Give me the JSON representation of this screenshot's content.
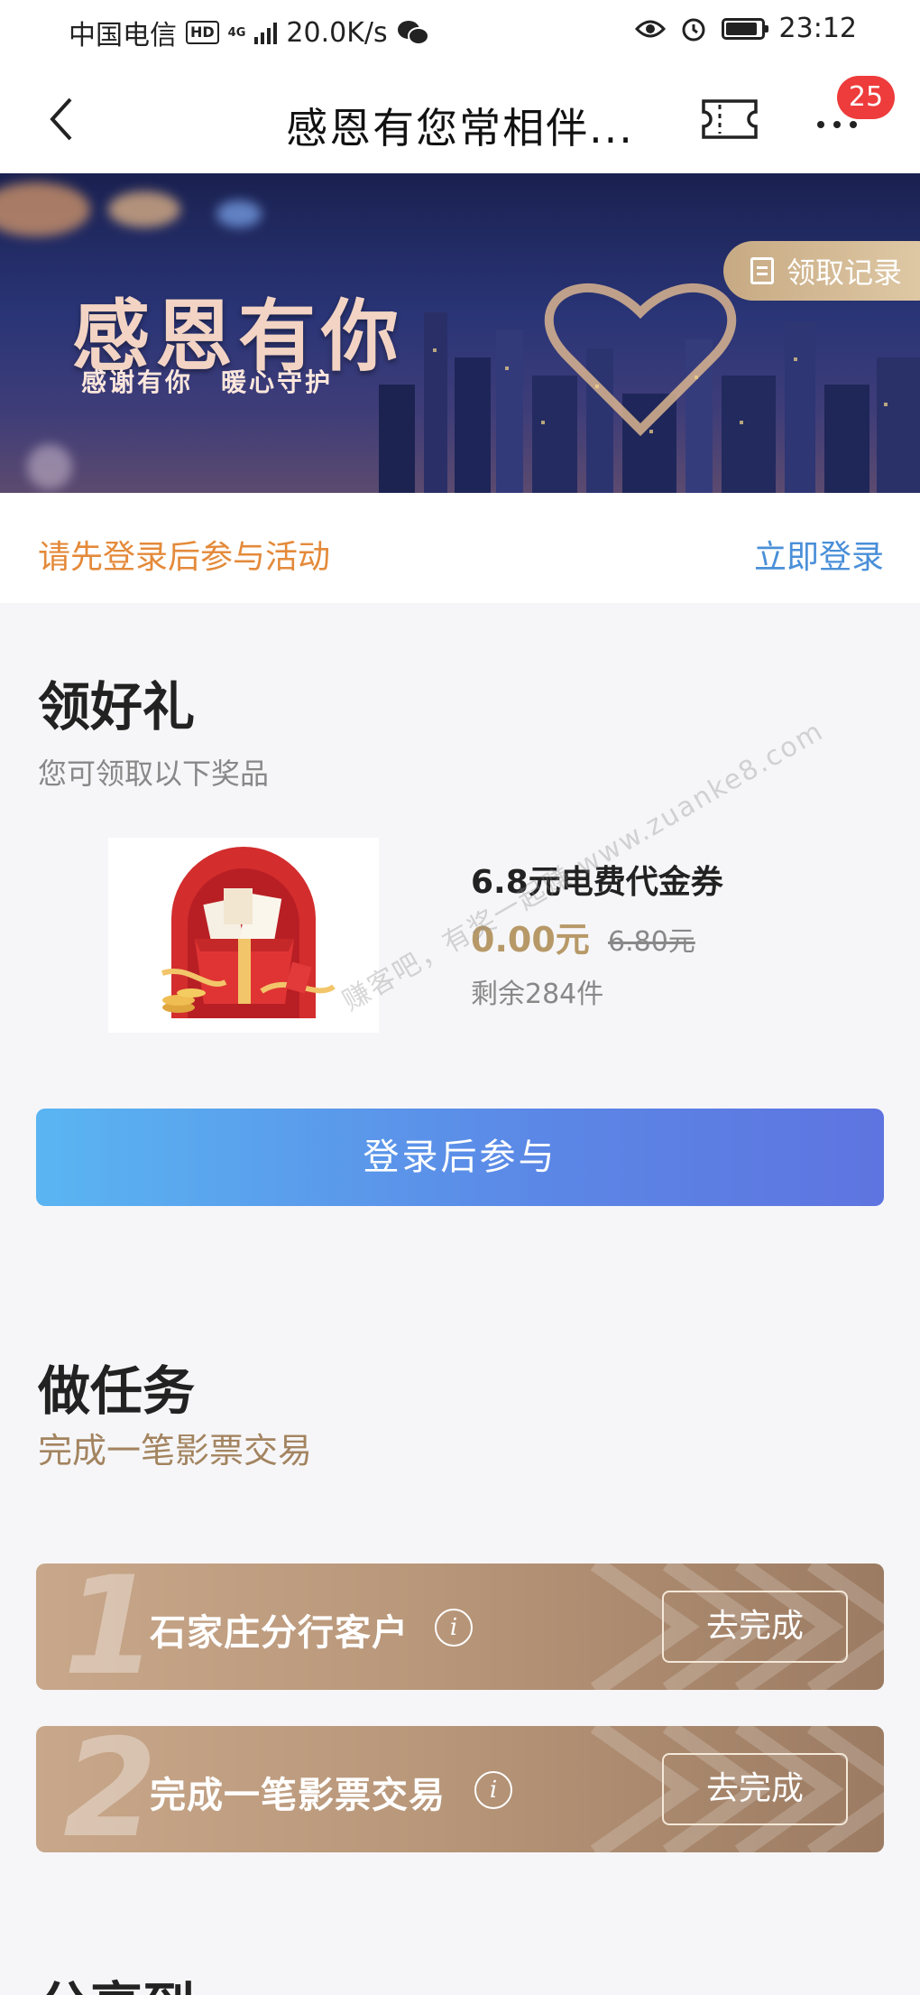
{
  "status_bar": {
    "carrier": "中国电信",
    "hd": "HD",
    "network": "4G",
    "speed": "20.0K/s",
    "time": "23:12",
    "battery_level": 0.8
  },
  "nav": {
    "title": "感恩有您常相伴...",
    "badge_count": "25"
  },
  "banner": {
    "title": "感恩有你",
    "subtitle": "感谢有你　暖心守护",
    "records_label": "领取记录"
  },
  "login": {
    "tip": "请先登录后参与活动",
    "link": "立即登录"
  },
  "gift_section": {
    "title": "领好礼",
    "subtitle": "您可领取以下奖品",
    "item": {
      "name": "6.8元电费代金券",
      "price": "0.00元",
      "original_price": "6.80元",
      "stock": "剩余284件"
    },
    "watermark": "赚客吧，有奖一起赚 www.zuanke8.com",
    "join_button": "登录后参与"
  },
  "task_section": {
    "title": "做任务",
    "subtitle": "完成一笔影票交易",
    "tasks": [
      {
        "num": "1",
        "label": "石家庄分行客户",
        "button": "去完成"
      },
      {
        "num": "2",
        "label": "完成一笔影票交易",
        "button": "去完成"
      }
    ]
  },
  "share_section": {
    "title": "分享到"
  }
}
